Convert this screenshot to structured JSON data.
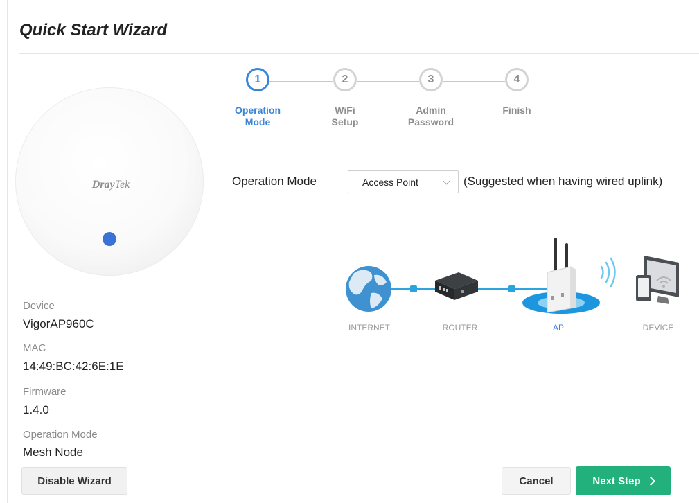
{
  "page": {
    "title": "Quick Start Wizard"
  },
  "device_image": {
    "brand": "DrayTek",
    "brand_bold": "Dray",
    "brand_light": "Tek"
  },
  "device_info": {
    "device_label": "Device",
    "device_value": "VigorAP960C",
    "mac_label": "MAC",
    "mac_value": "14:49:BC:42:6E:1E",
    "firmware_label": "Firmware",
    "firmware_value": "1.4.0",
    "opmode_label": "Operation Mode",
    "opmode_value": "Mesh Node"
  },
  "stepper": {
    "current_step": 1,
    "steps": [
      {
        "number": "1",
        "label": "Operation\nMode"
      },
      {
        "number": "2",
        "label": "WiFi\nSetup"
      },
      {
        "number": "3",
        "label": "Admin\nPassword"
      },
      {
        "number": "4",
        "label": "Finish"
      }
    ]
  },
  "operation_mode": {
    "label": "Operation Mode",
    "selected": "Access Point",
    "hint": "(Suggested when having wired uplink)"
  },
  "topology": {
    "labels": [
      "INTERNET",
      "ROUTER",
      "AP",
      "DEVICE"
    ],
    "icons": [
      "globe-icon",
      "router-icon",
      "access-point-icon",
      "devices-icon"
    ]
  },
  "buttons": {
    "disable_wizard": "Disable Wizard",
    "cancel": "Cancel",
    "next": "Next Step"
  },
  "colors": {
    "accent": "#3a85d8",
    "primary_button": "#22b07d",
    "led": "#3a73d6",
    "inactive_step": "#8d8d8d"
  }
}
